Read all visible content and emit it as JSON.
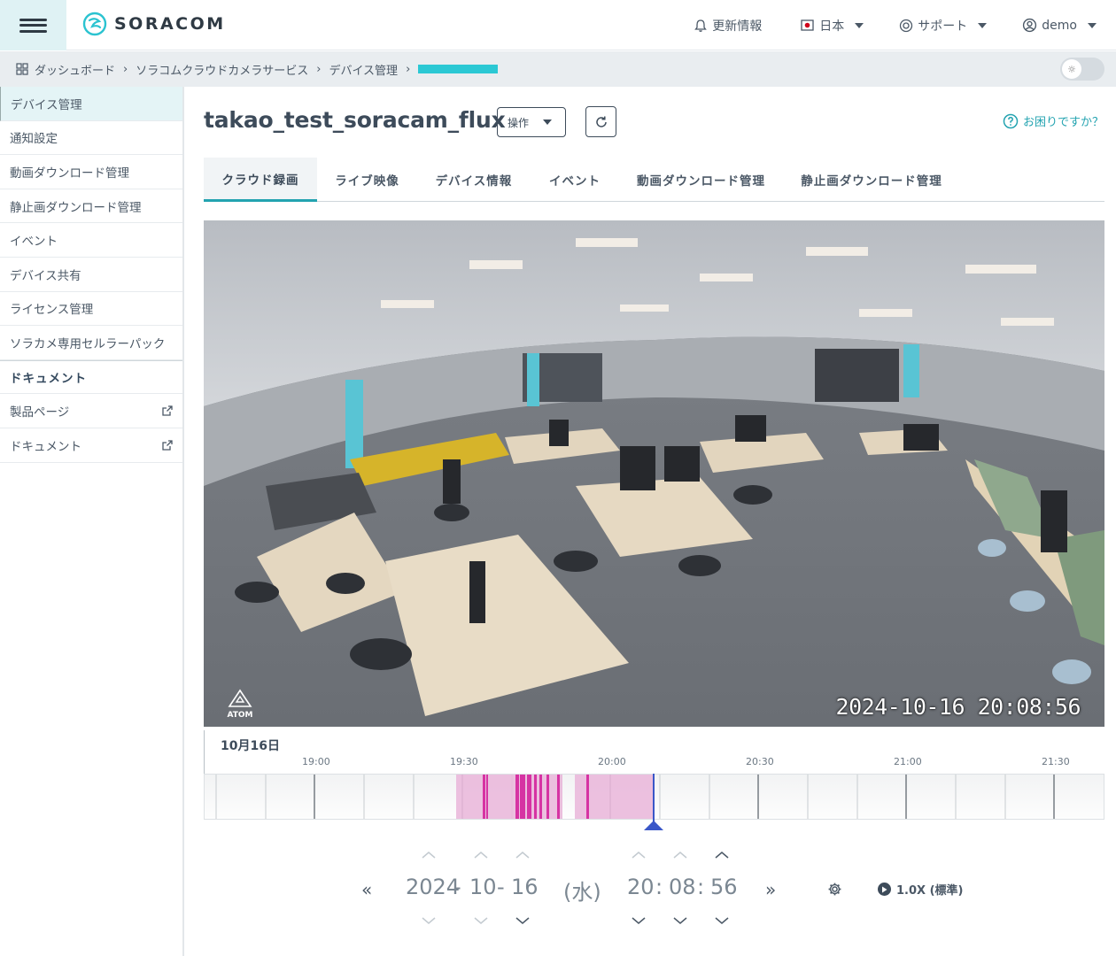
{
  "header": {
    "logo_text": "SORACOM",
    "news_label": "更新情報",
    "language_label": "日本",
    "support_label": "サポート",
    "user_label": "demo"
  },
  "breadcrumb": {
    "items": [
      "ダッシュボード",
      "ソラコムクラウドカメラサービス",
      "デバイス管理"
    ]
  },
  "sidebar": {
    "items": [
      {
        "label": "デバイス管理",
        "active": true
      },
      {
        "label": "通知設定"
      },
      {
        "label": "動画ダウンロード管理"
      },
      {
        "label": "静止画ダウンロード管理"
      },
      {
        "label": "イベント"
      },
      {
        "label": "デバイス共有"
      },
      {
        "label": "ライセンス管理"
      },
      {
        "label": "ソラカメ専用セルラーパック"
      }
    ],
    "section_heading": "ドキュメント",
    "doc_items": [
      {
        "label": "製品ページ"
      },
      {
        "label": "ドキュメント"
      }
    ]
  },
  "main": {
    "title": "takao_test_soracam_flux",
    "ops_label": "操作",
    "help_label": "お困りですか？",
    "tabs": [
      "クラウド録画",
      "ライブ映像",
      "デバイス情報",
      "イベント",
      "動画ダウンロード管理",
      "静止画ダウンロード管理"
    ]
  },
  "video": {
    "timestamp": "2024-10-16 20:08:56",
    "watermark": "ATOM"
  },
  "timeline": {
    "date_label": "10月16日",
    "ticks": [
      "19:00",
      "19:30",
      "20:00",
      "20:30",
      "21:00",
      "21:30"
    ]
  },
  "picker": {
    "year": "2024",
    "month": "10",
    "day": "16",
    "weekday": "(水)",
    "hour": "20",
    "minute": "08",
    "second": "56",
    "speed_label": "1.0X (標準)"
  },
  "colors": {
    "accent": "#23a3b0",
    "recording": "#e9b8da",
    "event": "#d633a3",
    "cursor": "#3a57c8"
  }
}
